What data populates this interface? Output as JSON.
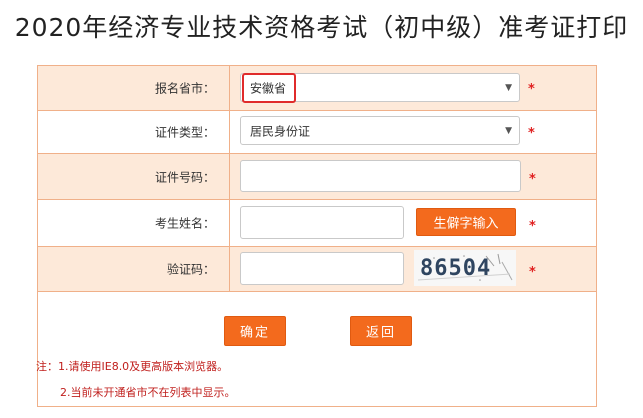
{
  "page": {
    "title": "2020年经济专业技术资格考试（初中级）准考证打印"
  },
  "form": {
    "rows": [
      {
        "label": "报名省市：",
        "type": "select",
        "value": "安徽省"
      },
      {
        "label": "证件类型：",
        "type": "select",
        "value": "居民身份证"
      },
      {
        "label": "证件号码：",
        "type": "input",
        "value": ""
      },
      {
        "label": "考生姓名：",
        "type": "input",
        "value": ""
      },
      {
        "label": "验证码：",
        "type": "input",
        "value": ""
      }
    ],
    "required_mark": "*",
    "rare_char_button": "生僻字输入",
    "captcha_text": "86504",
    "confirm_button": "确定",
    "back_button": "返回"
  },
  "notes": {
    "line1": "注：1.请使用IE8.0及更高版本浏览器。",
    "line2": "2.当前未开通省市不在列表中显示。"
  },
  "colors": {
    "accent_orange": "#f36a1d",
    "row_shade": "#fde9d9",
    "border": "#f0b089",
    "required_red": "#e02020"
  }
}
